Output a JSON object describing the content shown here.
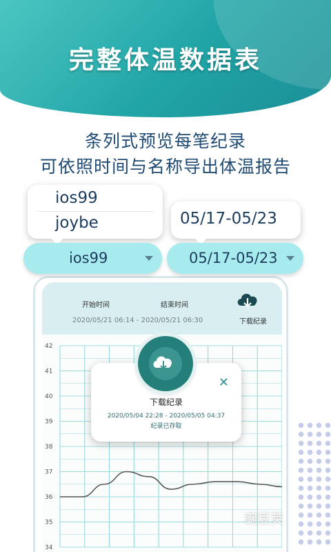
{
  "promo": {
    "headline": "完整体温数据表",
    "subtitle_line1": "条列式预览每笔纪录",
    "subtitle_line2": "可依照时间与名称导出体温报告"
  },
  "name_dropdown": {
    "options": [
      "ios99",
      "joybe"
    ],
    "selected": "ios99"
  },
  "date_dropdown": {
    "options": [
      "05/17-05/23"
    ],
    "selected": "05/17-05/23"
  },
  "record_header": {
    "start_label": "开始时间",
    "end_label": "结束时间",
    "range": "2020/05/21  06:14  -  2020/05/21  06:30",
    "download_label": "下载纪录",
    "download_icon": "cloud-download-icon"
  },
  "chart_data": {
    "type": "line",
    "title": "",
    "xlabel": "",
    "ylabel": "",
    "y_ticks": [
      "42",
      "41",
      "40",
      "39",
      "38",
      "37",
      "36",
      "35",
      "34"
    ],
    "ylim": [
      34,
      42
    ],
    "grid": true,
    "series": [
      {
        "color": "#555555",
        "x": [
          0,
          1,
          2,
          3,
          4,
          5,
          6,
          7,
          8,
          9,
          10
        ],
        "values": [
          36.0,
          36.0,
          36.5,
          37.0,
          36.8,
          36.3,
          36.5,
          36.6,
          36.6,
          36.5,
          36.4
        ]
      }
    ]
  },
  "download_dialog": {
    "title": "下载纪录",
    "range": "2020/05/04 22:28 - 2020/05/05 04:37",
    "status": "纪录已存取",
    "close_symbol": "✕",
    "icon": "cloud-download-icon",
    "accent": "#247f7a"
  },
  "watermark": {
    "text": "豌豆荚"
  }
}
